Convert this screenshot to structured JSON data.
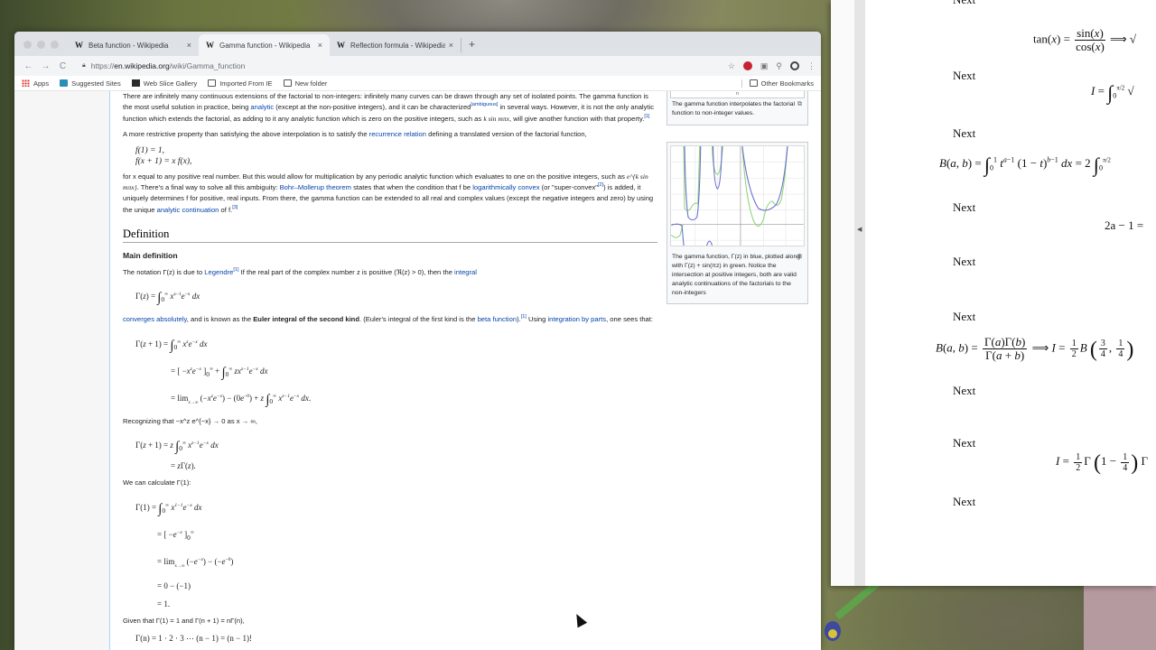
{
  "browser": {
    "tabs": [
      {
        "label": "Beta function - Wikipedia",
        "active": false
      },
      {
        "label": "Gamma function - Wikipedia",
        "active": true
      },
      {
        "label": "Reflection formula - Wikipedia",
        "active": false
      }
    ],
    "new_tab": "+",
    "tab_logo": "W",
    "tab_close": "×",
    "nav": {
      "back": "←",
      "forward": "→",
      "reload": "C"
    },
    "url": {
      "scheme": "https://",
      "host": "en.wikipedia.org",
      "path": "/wiki/Gamma_function"
    },
    "bookmarks": [
      {
        "label": "Apps",
        "icon": "apps-grid-icon"
      },
      {
        "label": "Suggested Sites",
        "icon": "bing-icon"
      },
      {
        "label": "Web Slice Gallery",
        "icon": "web-slice-icon"
      },
      {
        "label": "Imported From IE",
        "icon": "folder-icon"
      },
      {
        "label": "New folder",
        "icon": "folder-icon"
      }
    ],
    "other_bookmarks": "Other Bookmarks"
  },
  "article": {
    "p1": {
      "a": "There are infinitely many continuous extensions of the factorial to non-integers: infinitely many curves can be drawn through any set of isolated points. The gamma function is the most useful solution in practice, being ",
      "link_analytic": "analytic",
      "b": " (except at the non-positive integers), and it can be characterized",
      "sup_ambiguous": "[ambiguous]",
      "c": " in several ways. However, it is not the only analytic function which extends the factorial, as adding to it any analytic function which is zero on the positive integers, such as ",
      "math": "k sin mπx",
      "d": ", will give another function with that property.",
      "ref": "[1]"
    },
    "p2": {
      "a": "A more restrictive property than satisfying the above interpolation is to satisfy the ",
      "link": "recurrence relation",
      "b": " defining a translated version of the factorial function,"
    },
    "recurrence": [
      "f(1) = 1,",
      "f(x + 1) = x f(x),"
    ],
    "p3": {
      "a": "for x equal to any positive real number. But this would allow for multiplication by any periodic analytic function which evaluates to one on the positive integers, such as ",
      "math": "e^{k sin mπx}",
      "b": ". There's a final way to solve all this ambiguity: ",
      "link_bohr": "Bohr–Mollerup theorem",
      "c": " states that when the condition that f be ",
      "link_log": "logarithmically convex",
      "d": " (or \"super-convex\"",
      "ref2": "[2]",
      "e": ") is added, it uniquely determines f for positive, real inputs. From there, the gamma function can be extended to all real and complex values (except the negative integers and zero) by using the unique ",
      "link_cont": "analytic continuation",
      "f": " of f.",
      "ref3": "[3]"
    },
    "h2_definition": "Definition",
    "h3_main": "Main definition",
    "p4": {
      "a": "The notation Γ(z) is due to ",
      "link_legendre": "Legendre",
      "ref": "[1]",
      "b": " If the real part of the complex number z is positive (ℜ(z) > 0), then the ",
      "link_integral": "integral"
    },
    "eq_def": "Γ(z) = ∫₀^∞ x^{z−1} e^{−x} dx",
    "p5": {
      "link_conv": "converges absolutely",
      "a": ", and is known as the ",
      "bold": "Euler integral of the second kind",
      "b": ". (Euler's integral of the first kind is the ",
      "link_beta": "beta function",
      "c": ").",
      "ref": "[1]",
      "d": " Using ",
      "link_parts": "integration by parts",
      "e": ", one sees that:"
    },
    "eq_parts": [
      "Γ(z + 1) = ∫₀^∞ x^z e^{−x} dx",
      "= [−x^z e^{−x}]₀^∞ + ∫₀^∞ z x^{z−1} e^{−x} dx",
      "= lim_{x→∞} (−x^z e^{−x}) − (0e^{−0}) + z ∫₀^∞ x^{z−1} e^{−x} dx."
    ],
    "p6": "Recognizing that −x^z e^{−x} → 0 as x → ∞,",
    "eq_recog": [
      "Γ(z + 1) = z ∫₀^∞ x^{z−1} e^{−x} dx",
      "= zΓ(z)."
    ],
    "p7": "We can calculate Γ(1):",
    "eq_gamma1": [
      "Γ(1) = ∫₀^∞ x^{1−1} e^{−x} dx",
      "= [−e^{−x}]₀^∞",
      "= lim_{x→∞} (−e^{−x}) − (−e^{−0})",
      "= 0 − (−1)",
      "= 1."
    ],
    "p8": "Given that Γ(1) = 1 and Γ(n + 1) = nΓ(n),",
    "eq_fact": "Γ(n) = 1 · 2 · 3 ⋯ (n − 1) = (n − 1)!",
    "thumb1": {
      "axis_label": "n",
      "caption": "The gamma function interpolates the factorial function to non-integer values."
    },
    "thumb2": {
      "caption": "The gamma function, Γ(z) in blue, plotted along with Γ(z) + sin(πz) in green. Notice the intersection at positive integers, both are valid analytic continuations of the factorials to the non-integers"
    }
  },
  "notes": {
    "next_label": "Next",
    "eq_tan": "tan(x) = sin(x)/cos(x) ⟹ √",
    "eq_I": "I = ∫₀^{π/2} √",
    "eq_beta_int": "B(a,b) = ∫₀¹ t^{a−1} (1 − t)^{b−1} dx = 2 ∫₀^{π/2}",
    "eq_2a": "2a − 1 =",
    "eq_beta_gamma": "B(a,b) = Γ(a)Γ(b)/Γ(a+b) ⟹ I = ½ B(¾, ¼) =",
    "eq_final": "I = ½ Γ(1 − ¼) Γ"
  },
  "colors": {
    "link": "#0645ad",
    "blue_curve": "#6b6fd0",
    "green_curve": "#8fd47a"
  }
}
